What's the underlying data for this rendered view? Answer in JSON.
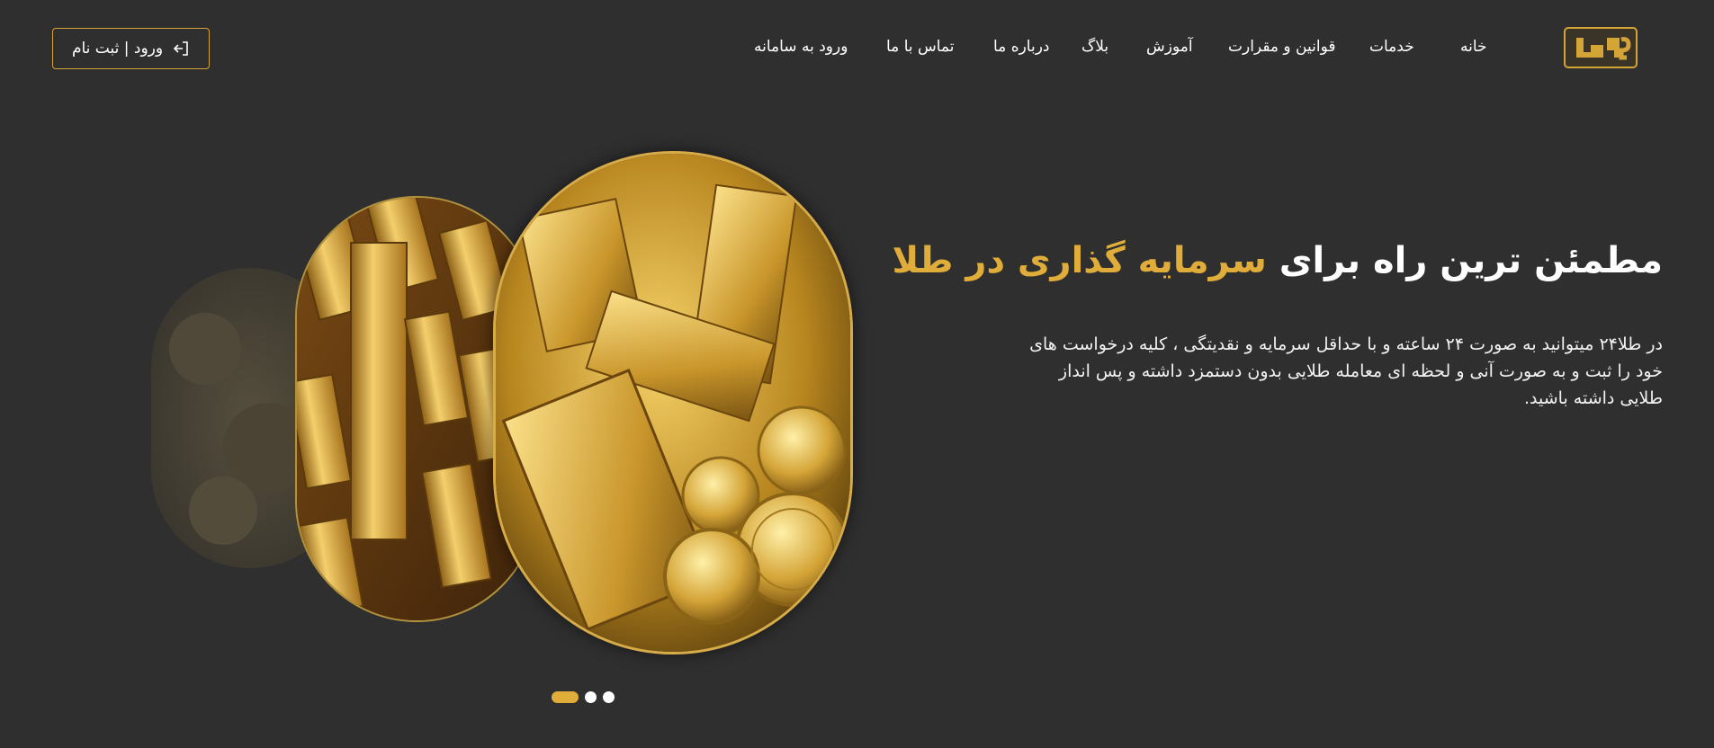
{
  "brand": {
    "logo_text": "طلا۲۴",
    "accent_color": "#e0ad3a",
    "background_color": "#2f2f2f"
  },
  "nav": {
    "items": [
      {
        "label": "خانه"
      },
      {
        "label": "خدمات"
      },
      {
        "label": "قوانین و مقرارت"
      },
      {
        "label": "آموزش"
      },
      {
        "label": "بلاگ"
      },
      {
        "label": "درباره ما"
      },
      {
        "label": "تماس با ما"
      },
      {
        "label": "ورود به سامانه"
      }
    ]
  },
  "auth": {
    "label": "ورود | ثبت نام",
    "icon": "login-arrow-icon"
  },
  "hero": {
    "title_white": "مطمئن ترین راه برای ",
    "title_gold": "سرمایه گذاری در طلا",
    "description": "در طلا۲۴ میتوانید به صورت ۲۴ ساعته و با حداقل سرمایه و نقدیتگی ، کلیه درخواست های خود را ثبت و به صورت آنی و لحظه ای معامله طلایی بدون دستمزد داشته و پس انداز طلایی داشته باشید."
  },
  "carousel": {
    "slide_count": 3,
    "active_index": 0,
    "images": [
      {
        "name": "gold-bars-and-coins"
      },
      {
        "name": "stacked-gold-bars"
      },
      {
        "name": "gold-coins-faded"
      }
    ]
  }
}
